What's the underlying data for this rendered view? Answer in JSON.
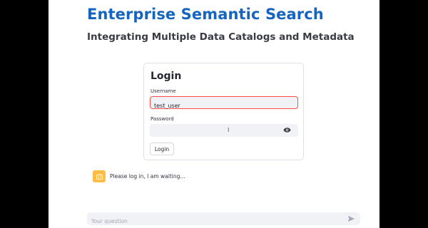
{
  "header": {
    "title": "Enterprise Semantic Search",
    "subtitle": "Integrating Multiple Data Catalogs and Metadata"
  },
  "login": {
    "title": "Login",
    "username_label": "Username",
    "username_value": "test_user",
    "password_label": "Password",
    "password_value": "",
    "button_label": "Login"
  },
  "message": {
    "text": "Please log in, I am waiting...",
    "avatar_icon": "bot-icon"
  },
  "chat_input": {
    "placeholder": "Your question",
    "send_icon": "send-icon"
  },
  "colors": {
    "title": "#1565c0",
    "avatar": "#ffbd45",
    "focus_border": "#ff4b4b",
    "field_bg": "#f0f2f6"
  }
}
